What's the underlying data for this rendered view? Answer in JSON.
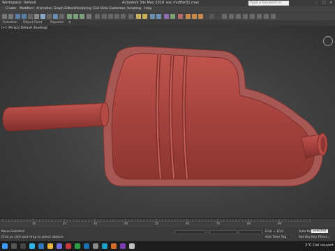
{
  "titlebar": {
    "workspace": "Workspace: Default",
    "app_title": "Autodesk 3ds Max 2018",
    "file": "exc muffler01.max",
    "search_placeholder": "Type a keyword or phrase"
  },
  "menu": [
    "Create",
    "Modifiers",
    "Animation",
    "Graph Editors",
    "Rendering",
    "Civil View",
    "Customize",
    "Scripting",
    "Help"
  ],
  "ribbon": [
    "Selection",
    "Object Paint",
    "Populate"
  ],
  "viewport": {
    "label": "[+] [Persp] [Default Shading]"
  },
  "timeline": {
    "ticks": [
      "10",
      "20",
      "30",
      "40",
      "50",
      "60",
      "70",
      "80",
      "90"
    ]
  },
  "status": {
    "selected": "None Selected",
    "hint": "Click or click-and-drag to select objects",
    "grid": "Grid = 10,0",
    "add_time_tag": "Add Time Tag",
    "auto_key": "Auto Key",
    "selected_dd": "Selected",
    "set_key": "Set Key",
    "key_filters": "Key Filters..."
  },
  "systray": {
    "weather": "2°C",
    "sky": "Ciel couvert"
  },
  "colors": {
    "muffler": "#a4413c",
    "ground": "#a85854"
  }
}
